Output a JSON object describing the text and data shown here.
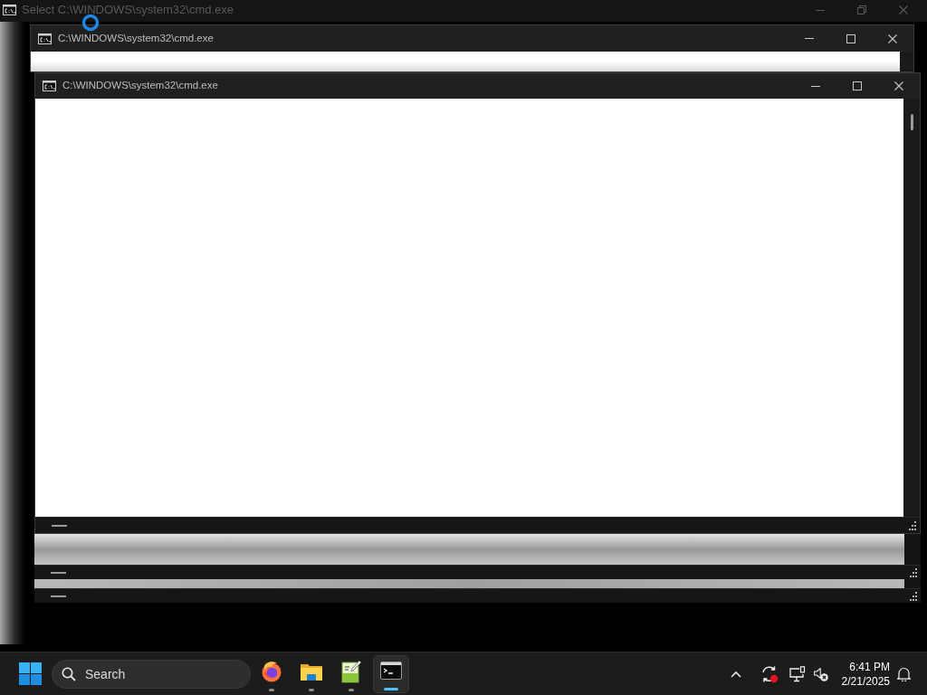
{
  "windows": [
    {
      "title": "Select C:\\WINDOWS\\system32\\cmd.exe",
      "dimmed": true,
      "maximized": true
    },
    {
      "title": "C:\\WINDOWS\\system32\\cmd.exe",
      "dimmed": false,
      "maximized": false
    },
    {
      "title": "C:\\WINDOWS\\system32\\cmd.exe",
      "dimmed": false,
      "maximized": false
    }
  ],
  "taskbar": {
    "search": {
      "placeholder": "Search"
    },
    "apps": [
      {
        "kind": "browser",
        "selected": false
      },
      {
        "kind": "folder",
        "selected": false
      },
      {
        "kind": "editor",
        "selected": false
      },
      {
        "kind": "terminal",
        "selected": true
      }
    ],
    "clock": {
      "time": "6:41 PM",
      "date": "2/21/2025"
    }
  }
}
